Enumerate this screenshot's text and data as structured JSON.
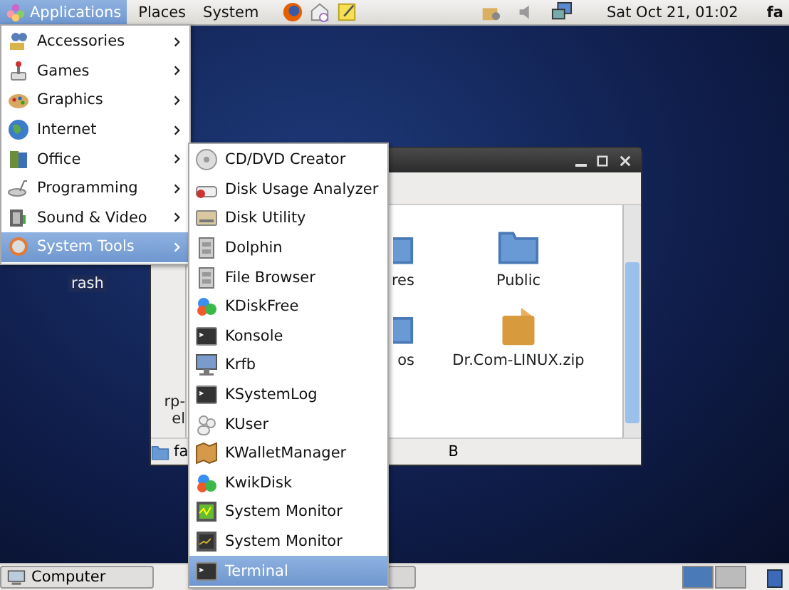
{
  "top_panel": {
    "menus": [
      {
        "label": "Applications",
        "selected": true
      },
      {
        "label": "Places",
        "selected": false
      },
      {
        "label": "System",
        "selected": false
      }
    ],
    "clock": "Sat Oct 21, 01:02",
    "user": "fa"
  },
  "applications_menu": {
    "items": [
      {
        "label": "Accessories",
        "selected": false
      },
      {
        "label": "Games",
        "selected": false
      },
      {
        "label": "Graphics",
        "selected": false
      },
      {
        "label": "Internet",
        "selected": false
      },
      {
        "label": "Office",
        "selected": false
      },
      {
        "label": "Programming",
        "selected": false
      },
      {
        "label": "Sound & Video",
        "selected": false
      },
      {
        "label": "System Tools",
        "selected": true
      }
    ]
  },
  "system_tools_menu": {
    "items": [
      {
        "label": "CD/DVD Creator",
        "selected": false
      },
      {
        "label": "Disk Usage Analyzer",
        "selected": false
      },
      {
        "label": "Disk Utility",
        "selected": false
      },
      {
        "label": "Dolphin",
        "selected": false
      },
      {
        "label": "File Browser",
        "selected": false
      },
      {
        "label": "KDiskFree",
        "selected": false
      },
      {
        "label": "Konsole",
        "selected": false
      },
      {
        "label": "Krfb",
        "selected": false
      },
      {
        "label": "KSystemLog",
        "selected": false
      },
      {
        "label": "KUser",
        "selected": false
      },
      {
        "label": "KWalletManager",
        "selected": false
      },
      {
        "label": "KwikDisk",
        "selected": false
      },
      {
        "label": "System Monitor",
        "selected": false
      },
      {
        "label": "System Monitor",
        "selected": false
      },
      {
        "label": "Terminal",
        "selected": true
      }
    ]
  },
  "desktop_icon": {
    "label": "rash"
  },
  "file_window": {
    "items": [
      {
        "label": "res",
        "kind": "folder"
      },
      {
        "label": "Public",
        "kind": "folder"
      },
      {
        "label": "os",
        "kind": "folder"
      },
      {
        "label": "Dr.Com-LINUX.zip",
        "kind": "archive"
      }
    ],
    "side_texts": [
      "rp-",
      "el"
    ],
    "location": "fa",
    "status": "B"
  },
  "bottom_panel": {
    "tasks": [
      {
        "label": "Computer",
        "selected": false
      }
    ]
  }
}
